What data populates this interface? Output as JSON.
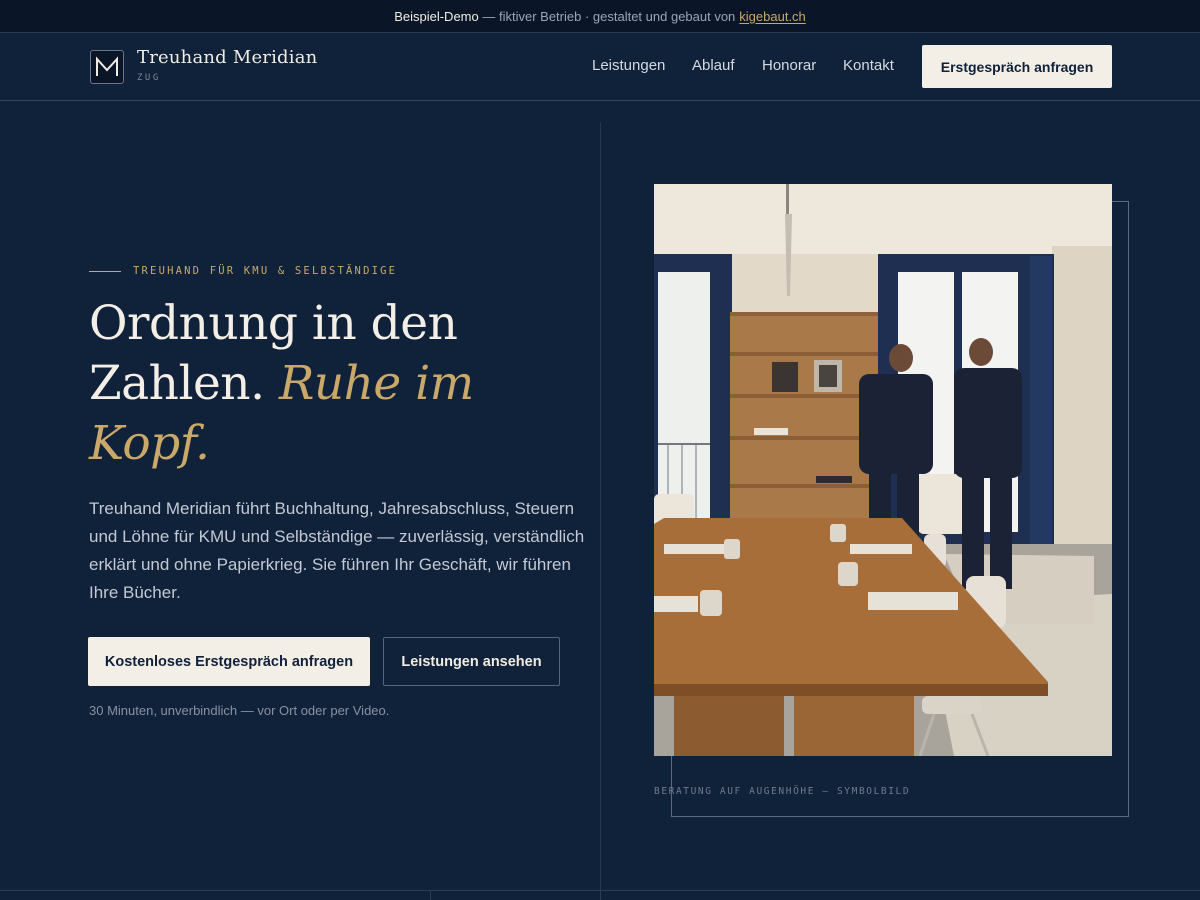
{
  "banner": {
    "strong": "Beispiel-Demo",
    "text": "— fiktiver Betrieb · gestaltet und gebaut von",
    "link": "kigebaut.ch"
  },
  "header": {
    "logo_letter": "M",
    "brand_name": "Treuhand Meridian",
    "brand_location": "ZUG",
    "nav": [
      "Leistungen",
      "Ablauf",
      "Honorar",
      "Kontakt"
    ],
    "cta": "Erstgespräch anfragen"
  },
  "hero": {
    "eyebrow": "TREUHAND FÜR KMU & SELBSTÄNDIGE",
    "headline_plain": "Ordnung in den Zahlen.",
    "headline_accent": "Ruhe im Kopf.",
    "lead": "Treuhand Meridian führt Buchhaltung, Jahresabschluss, Steuern und Löhne für KMU und Selbständige — zuverlässig, verständlich erklärt und ohne Papierkrieg. Sie führen Ihr Geschäft, wir führen Ihre Bücher.",
    "primary_button": "Kostenloses Erstgespräch anfragen",
    "secondary_button": "Leistungen ansehen",
    "note": "30 Minuten, unverbindlich — vor Ort oder per Video.",
    "image_caption": "BERATUNG AUF AUGENHÖHE — SYMBOLBILD"
  },
  "colors": {
    "background": "#10213a",
    "banner": "#0a1628",
    "accent_gold": "#c9a86a",
    "cream": "#f4efe6"
  }
}
